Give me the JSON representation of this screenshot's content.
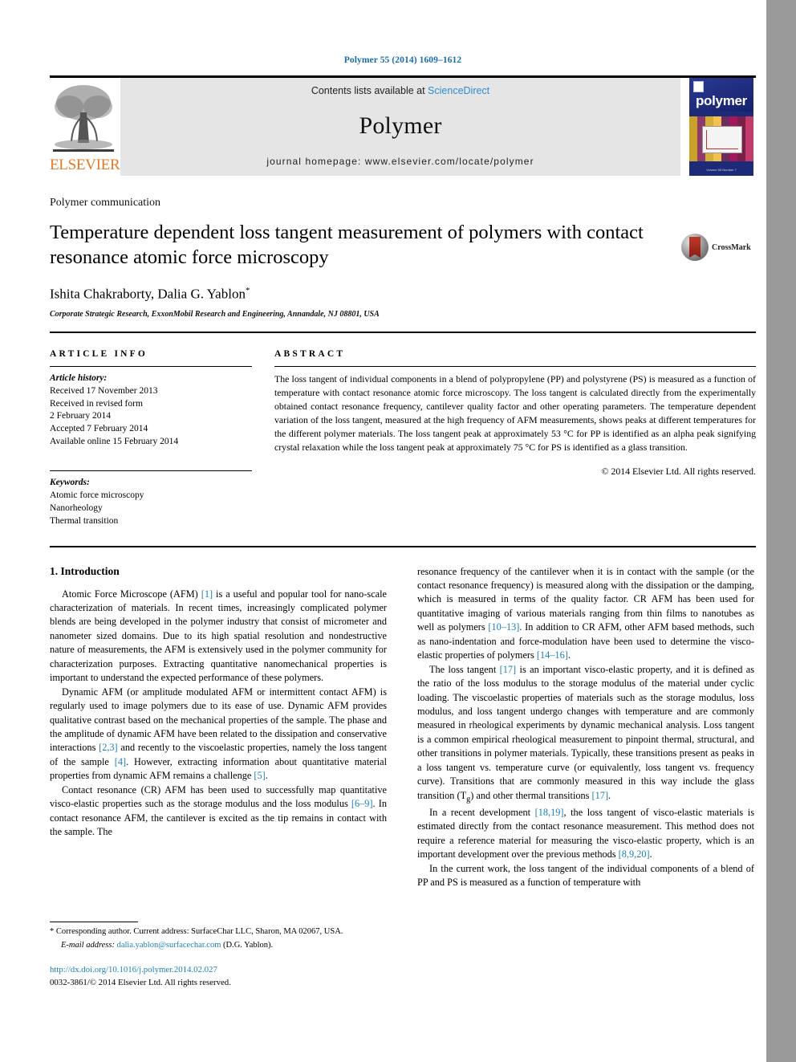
{
  "page": {
    "running_head": "Polymer 55 (2014) 1609–1612"
  },
  "masthead": {
    "publisher_name": "ELSEVIER",
    "contents_prefix": "Contents lists available at ",
    "contents_link": "ScienceDirect",
    "journal_title": "Polymer",
    "homepage_line": "journal homepage: www.elsevier.com/locate/polymer",
    "cover": {
      "word": "polymer",
      "footer_text": "Volume 55  Number 7"
    }
  },
  "article": {
    "section_type": "Polymer communication",
    "title": "Temperature dependent loss tangent measurement of polymers with contact resonance atomic force microscopy",
    "authors": "Ishita Chakraborty, Dalia G. Yablon",
    "author_marker": "*",
    "affiliation": "Corporate Strategic Research, ExxonMobil Research and Engineering, Annandale, NJ 08801, USA",
    "crossmark_label": "CrossMark"
  },
  "info": {
    "header": "ARTICLE INFO",
    "history_label": "Article history:",
    "history": [
      "Received 17 November 2013",
      "Received in revised form",
      "2 February 2014",
      "Accepted 7 February 2014",
      "Available online 15 February 2014"
    ],
    "keywords_label": "Keywords:",
    "keywords": [
      "Atomic force microscopy",
      "Nanorheology",
      "Thermal transition"
    ]
  },
  "abstract": {
    "header": "ABSTRACT",
    "text": "The loss tangent of individual components in a blend of polypropylene (PP) and polystyrene (PS) is measured as a function of temperature with contact resonance atomic force microscopy. The loss tangent is calculated directly from the experimentally obtained contact resonance frequency, cantilever quality factor and other operating parameters. The temperature dependent variation of the loss tangent, measured at the high frequency of AFM measurements, shows peaks at different temperatures for the different polymer materials. The loss tangent peak at approximately 53 °C for PP is identified as an alpha peak signifying crystal relaxation while the loss tangent peak at approximately 75 °C for PS is identified as a glass transition.",
    "copyright": "© 2014 Elsevier Ltd. All rights reserved."
  },
  "body": {
    "section_heading": "1. Introduction",
    "left_paragraphs": [
      {
        "parts": [
          {
            "t": "Atomic Force Microscope (AFM) "
          },
          {
            "t": "[1]",
            "ref": true
          },
          {
            "t": " is a useful and popular tool for nano-scale characterization of materials. In recent times, increasingly complicated polymer blends are being developed in the polymer industry that consist of micrometer and nanometer sized domains. Due to its high spatial resolution and nondestructive nature of measurements, the AFM is extensively used in the polymer community for characterization purposes. Extracting quantitative nanomechanical properties is important to understand the expected performance of these polymers."
          }
        ]
      },
      {
        "parts": [
          {
            "t": "Dynamic AFM (or amplitude modulated AFM or intermittent contact AFM) is regularly used to image polymers due to its ease of use. Dynamic AFM provides qualitative contrast based on the mechanical properties of the sample. The phase and the amplitude of dynamic AFM have been related to the dissipation and conservative interactions "
          },
          {
            "t": "[2,3]",
            "ref": true
          },
          {
            "t": " and recently to the viscoelastic properties, namely the loss tangent of the sample "
          },
          {
            "t": "[4]",
            "ref": true
          },
          {
            "t": ". However, extracting information about quantitative material properties from dynamic AFM remains a challenge "
          },
          {
            "t": "[5]",
            "ref": true
          },
          {
            "t": "."
          }
        ]
      },
      {
        "parts": [
          {
            "t": "Contact resonance (CR) AFM has been used to successfully map quantitative visco-elastic properties such as the storage modulus and the loss modulus "
          },
          {
            "t": "[6–9]",
            "ref": true
          },
          {
            "t": ". In contact resonance AFM, the cantilever is excited as the tip remains in contact with the sample. The"
          }
        ]
      }
    ],
    "right_paragraphs": [
      {
        "noindent": true,
        "parts": [
          {
            "t": "resonance frequency of the cantilever when it is in contact with the sample (or the contact resonance frequency) is measured along with the dissipation or the damping, which is measured in terms of the quality factor. CR AFM has been used for quantitative imaging of various materials ranging from thin films to nanotubes as well as polymers "
          },
          {
            "t": "[10–13]",
            "ref": true
          },
          {
            "t": ". In addition to CR AFM, other AFM based methods, such as nano-indentation and force-modulation have been used to determine the visco-elastic properties of polymers "
          },
          {
            "t": "[14–16]",
            "ref": true
          },
          {
            "t": "."
          }
        ]
      },
      {
        "parts": [
          {
            "t": "The loss tangent "
          },
          {
            "t": "[17]",
            "ref": true
          },
          {
            "t": " is an important visco-elastic property, and it is defined as the ratio of the loss modulus to the storage modulus of the material under cyclic loading. The viscoelastic properties of materials such as the storage modulus, loss modulus, and loss tangent undergo changes with temperature and are commonly measured in rheological experiments by dynamic mechanical analysis. Loss tangent is a common empirical rheological measurement to pinpoint thermal, structural, and other transitions in polymer materials. Typically, these transitions present as peaks in a loss tangent vs. temperature curve (or equivalently, loss tangent vs. frequency curve). Transitions that are commonly measured in this way include the glass transition (T"
          },
          {
            "t": "g",
            "sub": true
          },
          {
            "t": ") and other thermal transitions "
          },
          {
            "t": "[17]",
            "ref": true
          },
          {
            "t": "."
          }
        ]
      },
      {
        "parts": [
          {
            "t": "In a recent development "
          },
          {
            "t": "[18,19]",
            "ref": true
          },
          {
            "t": ", the loss tangent of visco-elastic materials is estimated directly from the contact resonance measurement. This method does not require a reference material for measuring the visco-elastic property, which is an important development over the previous methods "
          },
          {
            "t": "[8,9,20]",
            "ref": true
          },
          {
            "t": "."
          }
        ]
      },
      {
        "parts": [
          {
            "t": "In the current work, the loss tangent of the individual components of a blend of PP and PS is measured as a function of temperature with"
          }
        ]
      }
    ]
  },
  "footer": {
    "corresponding_marker": "*",
    "corresponding_text": " Corresponding author. Current address: SurfaceChar LLC, Sharon, MA 02067, USA.",
    "email_label": "E-mail address:",
    "email": "dalia.yablon@surfacechar.com",
    "email_owner": "(D.G. Yablon).",
    "doi": "http://dx.doi.org/10.1016/j.polymer.2014.02.027",
    "issn_line": "0032-3861/© 2014 Elsevier Ltd. All rights reserved."
  },
  "colors": {
    "link": "#1b7fb5",
    "sciencedirect": "#2d8cd0",
    "elsevier_orange": "#e87722",
    "masthead_bg": "#e5e5e5",
    "gutter": "#9a9a9a"
  }
}
